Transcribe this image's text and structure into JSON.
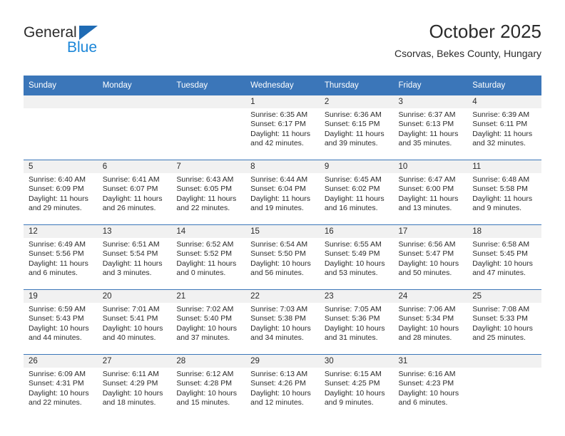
{
  "brand": {
    "name_top": "General",
    "name_bottom": "Blue",
    "triangle_icon": "triangle-icon",
    "primary_color": "#1f6bb4",
    "accent_color": "#1b86d8"
  },
  "header": {
    "title": "October 2025",
    "subtitle": "Csorvas, Bekes County, Hungary"
  },
  "calendar": {
    "header_bg": "#3b76b9",
    "date_band_bg": "#f1f1f1",
    "weekdays": [
      "Sunday",
      "Monday",
      "Tuesday",
      "Wednesday",
      "Thursday",
      "Friday",
      "Saturday"
    ],
    "weeks": [
      [
        {
          "date": "",
          "empty": true
        },
        {
          "date": "",
          "empty": true
        },
        {
          "date": "",
          "empty": true
        },
        {
          "date": "1",
          "sunrise": "Sunrise: 6:35 AM",
          "sunset": "Sunset: 6:17 PM",
          "daylight1": "Daylight: 11 hours",
          "daylight2": "and 42 minutes."
        },
        {
          "date": "2",
          "sunrise": "Sunrise: 6:36 AM",
          "sunset": "Sunset: 6:15 PM",
          "daylight1": "Daylight: 11 hours",
          "daylight2": "and 39 minutes."
        },
        {
          "date": "3",
          "sunrise": "Sunrise: 6:37 AM",
          "sunset": "Sunset: 6:13 PM",
          "daylight1": "Daylight: 11 hours",
          "daylight2": "and 35 minutes."
        },
        {
          "date": "4",
          "sunrise": "Sunrise: 6:39 AM",
          "sunset": "Sunset: 6:11 PM",
          "daylight1": "Daylight: 11 hours",
          "daylight2": "and 32 minutes."
        }
      ],
      [
        {
          "date": "5",
          "sunrise": "Sunrise: 6:40 AM",
          "sunset": "Sunset: 6:09 PM",
          "daylight1": "Daylight: 11 hours",
          "daylight2": "and 29 minutes."
        },
        {
          "date": "6",
          "sunrise": "Sunrise: 6:41 AM",
          "sunset": "Sunset: 6:07 PM",
          "daylight1": "Daylight: 11 hours",
          "daylight2": "and 26 minutes."
        },
        {
          "date": "7",
          "sunrise": "Sunrise: 6:43 AM",
          "sunset": "Sunset: 6:05 PM",
          "daylight1": "Daylight: 11 hours",
          "daylight2": "and 22 minutes."
        },
        {
          "date": "8",
          "sunrise": "Sunrise: 6:44 AM",
          "sunset": "Sunset: 6:04 PM",
          "daylight1": "Daylight: 11 hours",
          "daylight2": "and 19 minutes."
        },
        {
          "date": "9",
          "sunrise": "Sunrise: 6:45 AM",
          "sunset": "Sunset: 6:02 PM",
          "daylight1": "Daylight: 11 hours",
          "daylight2": "and 16 minutes."
        },
        {
          "date": "10",
          "sunrise": "Sunrise: 6:47 AM",
          "sunset": "Sunset: 6:00 PM",
          "daylight1": "Daylight: 11 hours",
          "daylight2": "and 13 minutes."
        },
        {
          "date": "11",
          "sunrise": "Sunrise: 6:48 AM",
          "sunset": "Sunset: 5:58 PM",
          "daylight1": "Daylight: 11 hours",
          "daylight2": "and 9 minutes."
        }
      ],
      [
        {
          "date": "12",
          "sunrise": "Sunrise: 6:49 AM",
          "sunset": "Sunset: 5:56 PM",
          "daylight1": "Daylight: 11 hours",
          "daylight2": "and 6 minutes."
        },
        {
          "date": "13",
          "sunrise": "Sunrise: 6:51 AM",
          "sunset": "Sunset: 5:54 PM",
          "daylight1": "Daylight: 11 hours",
          "daylight2": "and 3 minutes."
        },
        {
          "date": "14",
          "sunrise": "Sunrise: 6:52 AM",
          "sunset": "Sunset: 5:52 PM",
          "daylight1": "Daylight: 11 hours",
          "daylight2": "and 0 minutes."
        },
        {
          "date": "15",
          "sunrise": "Sunrise: 6:54 AM",
          "sunset": "Sunset: 5:50 PM",
          "daylight1": "Daylight: 10 hours",
          "daylight2": "and 56 minutes."
        },
        {
          "date": "16",
          "sunrise": "Sunrise: 6:55 AM",
          "sunset": "Sunset: 5:49 PM",
          "daylight1": "Daylight: 10 hours",
          "daylight2": "and 53 minutes."
        },
        {
          "date": "17",
          "sunrise": "Sunrise: 6:56 AM",
          "sunset": "Sunset: 5:47 PM",
          "daylight1": "Daylight: 10 hours",
          "daylight2": "and 50 minutes."
        },
        {
          "date": "18",
          "sunrise": "Sunrise: 6:58 AM",
          "sunset": "Sunset: 5:45 PM",
          "daylight1": "Daylight: 10 hours",
          "daylight2": "and 47 minutes."
        }
      ],
      [
        {
          "date": "19",
          "sunrise": "Sunrise: 6:59 AM",
          "sunset": "Sunset: 5:43 PM",
          "daylight1": "Daylight: 10 hours",
          "daylight2": "and 44 minutes."
        },
        {
          "date": "20",
          "sunrise": "Sunrise: 7:01 AM",
          "sunset": "Sunset: 5:41 PM",
          "daylight1": "Daylight: 10 hours",
          "daylight2": "and 40 minutes."
        },
        {
          "date": "21",
          "sunrise": "Sunrise: 7:02 AM",
          "sunset": "Sunset: 5:40 PM",
          "daylight1": "Daylight: 10 hours",
          "daylight2": "and 37 minutes."
        },
        {
          "date": "22",
          "sunrise": "Sunrise: 7:03 AM",
          "sunset": "Sunset: 5:38 PM",
          "daylight1": "Daylight: 10 hours",
          "daylight2": "and 34 minutes."
        },
        {
          "date": "23",
          "sunrise": "Sunrise: 7:05 AM",
          "sunset": "Sunset: 5:36 PM",
          "daylight1": "Daylight: 10 hours",
          "daylight2": "and 31 minutes."
        },
        {
          "date": "24",
          "sunrise": "Sunrise: 7:06 AM",
          "sunset": "Sunset: 5:34 PM",
          "daylight1": "Daylight: 10 hours",
          "daylight2": "and 28 minutes."
        },
        {
          "date": "25",
          "sunrise": "Sunrise: 7:08 AM",
          "sunset": "Sunset: 5:33 PM",
          "daylight1": "Daylight: 10 hours",
          "daylight2": "and 25 minutes."
        }
      ],
      [
        {
          "date": "26",
          "sunrise": "Sunrise: 6:09 AM",
          "sunset": "Sunset: 4:31 PM",
          "daylight1": "Daylight: 10 hours",
          "daylight2": "and 22 minutes."
        },
        {
          "date": "27",
          "sunrise": "Sunrise: 6:11 AM",
          "sunset": "Sunset: 4:29 PM",
          "daylight1": "Daylight: 10 hours",
          "daylight2": "and 18 minutes."
        },
        {
          "date": "28",
          "sunrise": "Sunrise: 6:12 AM",
          "sunset": "Sunset: 4:28 PM",
          "daylight1": "Daylight: 10 hours",
          "daylight2": "and 15 minutes."
        },
        {
          "date": "29",
          "sunrise": "Sunrise: 6:13 AM",
          "sunset": "Sunset: 4:26 PM",
          "daylight1": "Daylight: 10 hours",
          "daylight2": "and 12 minutes."
        },
        {
          "date": "30",
          "sunrise": "Sunrise: 6:15 AM",
          "sunset": "Sunset: 4:25 PM",
          "daylight1": "Daylight: 10 hours",
          "daylight2": "and 9 minutes."
        },
        {
          "date": "31",
          "sunrise": "Sunrise: 6:16 AM",
          "sunset": "Sunset: 4:23 PM",
          "daylight1": "Daylight: 10 hours",
          "daylight2": "and 6 minutes."
        },
        {
          "date": "",
          "empty": true
        }
      ]
    ]
  }
}
